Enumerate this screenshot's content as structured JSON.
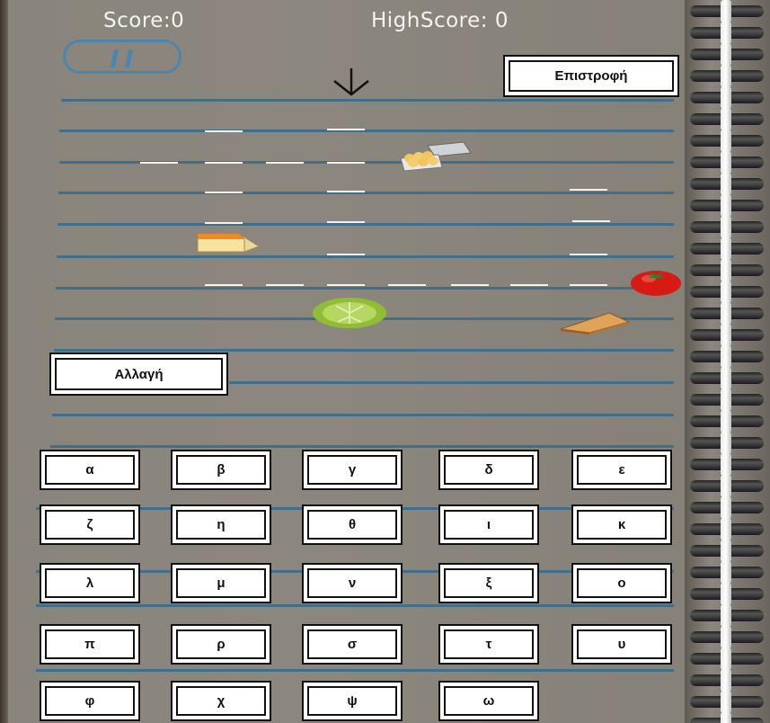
{
  "hud": {
    "score": "Score:0",
    "high_score": "HighScore: 0"
  },
  "buttons": {
    "back": "Επιστροφή",
    "change": "Αλλαγή"
  },
  "letters": [
    "α",
    "β",
    "γ",
    "δ",
    "ε",
    "ζ",
    "η",
    "θ",
    "ι",
    "κ",
    "λ",
    "μ",
    "ν",
    "ξ",
    "ο",
    "π",
    "ρ",
    "σ",
    "τ",
    "υ",
    "φ",
    "χ",
    "ψ",
    "ω"
  ],
  "icons": [
    "pause-icon",
    "down-arrow-icon",
    "egg-carton-icon",
    "cheese-icon",
    "tomato-icon",
    "lettuce-icon",
    "pie-slice-icon"
  ],
  "colors": {
    "ruled_line": "#3f6f8c",
    "dash": "#f2f2f2",
    "pause": "#4a86b0"
  }
}
